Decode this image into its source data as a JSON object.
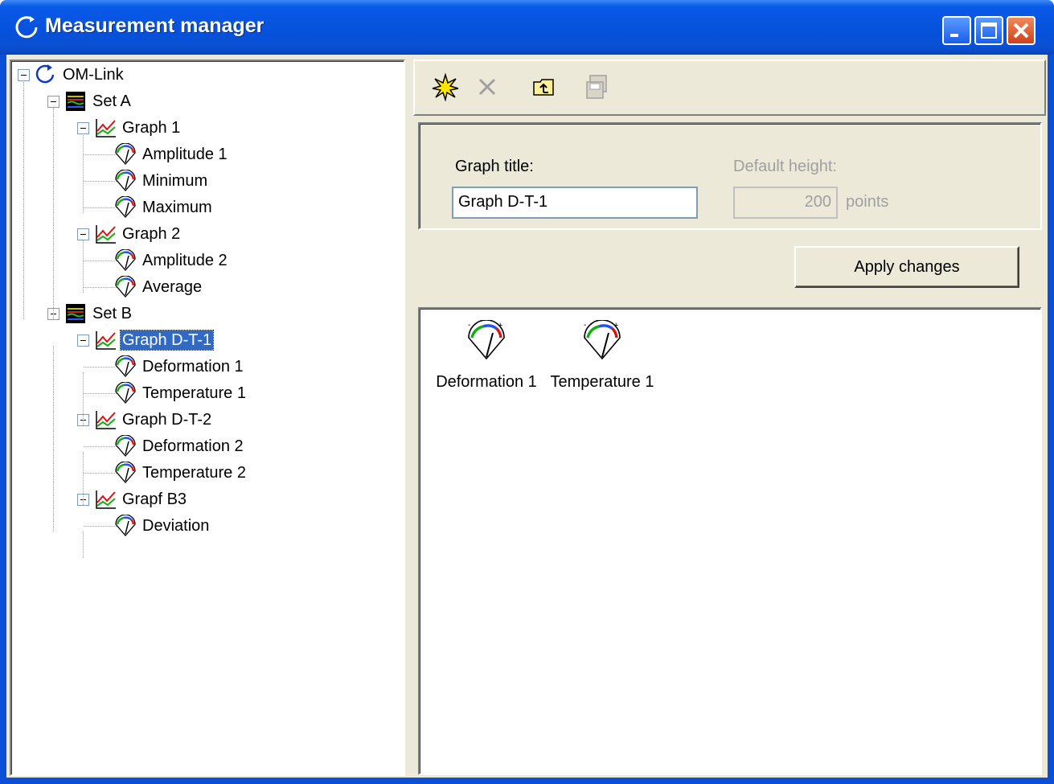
{
  "window": {
    "title": "Measurement manager",
    "controls": [
      "minimize-icon",
      "maximize-icon",
      "close-icon"
    ]
  },
  "tree": {
    "root": "OM-Link",
    "sets": [
      {
        "label": "Set A",
        "graphs": [
          {
            "label": "Graph 1",
            "items": [
              "Amplitude 1",
              "Minimum",
              "Maximum"
            ]
          },
          {
            "label": "Graph 2",
            "items": [
              "Amplitude 2",
              "Average"
            ]
          }
        ]
      },
      {
        "label": "Set B",
        "graphs": [
          {
            "label": "Graph D-T-1",
            "items": [
              "Deformation 1",
              "Temperature 1"
            ],
            "selected": true
          },
          {
            "label": "Graph D-T-2",
            "items": [
              "Deformation 2",
              "Temperature 2"
            ]
          },
          {
            "label": "Grapf B3",
            "items": [
              "Deviation"
            ]
          }
        ]
      }
    ]
  },
  "toolbar": {
    "buttons": [
      {
        "icon": "new-icon",
        "enabled": true
      },
      {
        "icon": "delete-icon",
        "enabled": false
      },
      {
        "icon": "up-folder-icon",
        "enabled": true
      },
      {
        "icon": "save-icon",
        "enabled": false
      }
    ]
  },
  "props": {
    "graph_title_label": "Graph title:",
    "graph_title_value": "Graph D-T-1",
    "default_height_label": "Default height:",
    "default_height_value": "200",
    "default_height_unit": "points",
    "apply_label": "Apply changes"
  },
  "list": {
    "items": [
      "Deformation 1",
      "Temperature 1"
    ]
  },
  "colors": {
    "titlebar": "#0a5ae8",
    "selection": "#316ac5",
    "face": "#ece9d8"
  }
}
